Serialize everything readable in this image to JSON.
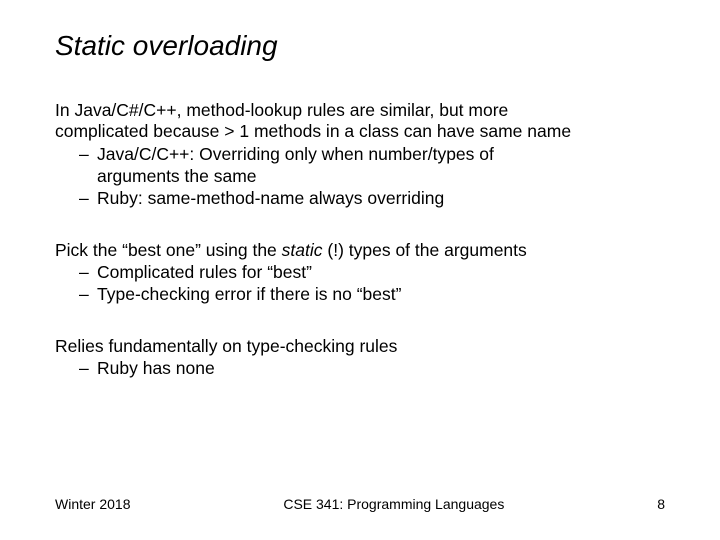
{
  "title": "Static overloading",
  "p1_a": "In Java/C#/C++, method-lookup rules are similar, but more",
  "p1_b": "complicated because > 1 methods in a class can have same name",
  "p1_s1a": "Java/C/C++: Overriding only when number/types of",
  "p1_s1b": "arguments the same",
  "p1_s2": "Ruby: same-method-name always overriding",
  "p2_a": "Pick the “best one” using the ",
  "p2_italic": "static",
  "p2_b": " (!) types of the arguments",
  "p2_s1": "Complicated rules for “best”",
  "p2_s2": "Type-checking error if there is no “best”",
  "p3": "Relies fundamentally on type-checking rules",
  "p3_s1": "Ruby has none",
  "footer_left": "Winter 2018",
  "footer_center": "CSE 341: Programming Languages",
  "footer_right": "8",
  "dash": "–"
}
